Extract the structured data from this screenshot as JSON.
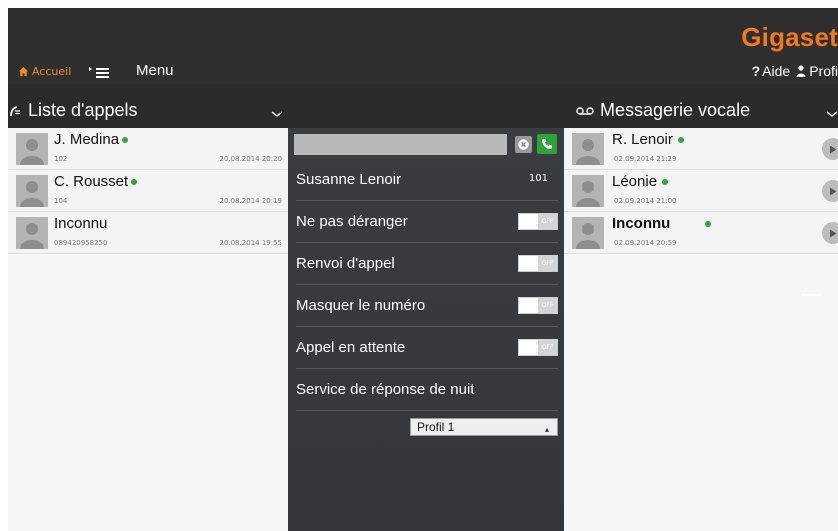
{
  "brand": "Gigaset",
  "nav": {
    "home": "Accueil",
    "menu": "Menu",
    "help_glyph": "?",
    "help": "Aide",
    "profile": "Profi"
  },
  "calls": {
    "title": "Liste d'appels",
    "items": [
      {
        "name": "J. Medina",
        "number": "102",
        "time": "20.08.2014 20:20",
        "online": true
      },
      {
        "name": "C. Rousset",
        "number": "104",
        "time": "20.08.2014 20:19",
        "online": true
      },
      {
        "name": "Inconnu",
        "number": "089420958250",
        "time": "20.08.2014 19:55",
        "online": false
      }
    ]
  },
  "settings": {
    "contact_name": "Susanne Lenoir",
    "contact_ext": "101",
    "toggles": [
      {
        "label": "Ne pas déranger",
        "state": "OFF"
      },
      {
        "label": "Renvoi d'appel",
        "state": "OFF"
      },
      {
        "label": "Masquer le numéro",
        "state": "OFF"
      },
      {
        "label": "Appel en attente",
        "state": "OFF"
      }
    ],
    "night_service": "Service de réponse de nuit",
    "profile_value": "Profil 1"
  },
  "voicemail": {
    "title": "Messagerie vocale",
    "items": [
      {
        "name": "R. Lenoir",
        "time": "02.09.2014 21:29",
        "online": true
      },
      {
        "name": "Léonie",
        "time": "02.09.2014 21:00",
        "online": true
      },
      {
        "name": "Inconnu",
        "time": "02.09.2014 20:59",
        "online": true
      }
    ]
  },
  "colors": {
    "accent": "#f07a1d",
    "online": "#2fa83a",
    "header_bg": "#2f2f2f",
    "panel_bg": "#3a3d40"
  },
  "icons": [
    "home-icon",
    "menu-icon",
    "help-icon",
    "user-icon",
    "call-log-icon",
    "voicemail-icon",
    "chevron-down-icon",
    "clear-icon",
    "phone-icon",
    "play-icon"
  ]
}
